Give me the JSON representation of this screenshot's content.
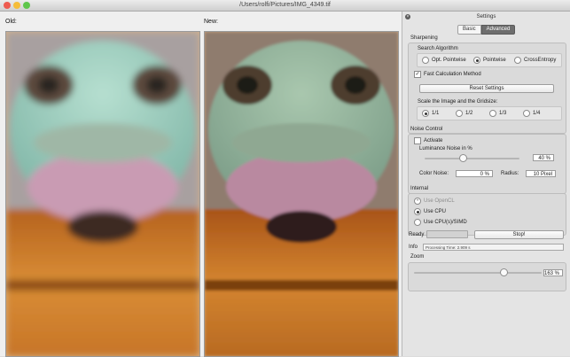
{
  "window": {
    "title": "/Users/rolfi/Pictures/IMG_4349.tif"
  },
  "viewer": {
    "old_label": "Old:",
    "new_label": "New:"
  },
  "settings": {
    "title": "Settings",
    "tabs": [
      {
        "label": "Basic",
        "active": false
      },
      {
        "label": "Advanced",
        "active": true
      }
    ],
    "sharpening": {
      "label": "Sharpening",
      "search_algorithm": {
        "label": "Search Algorithm",
        "options": [
          "Opt. Pointwise",
          "Pointwise",
          "CrossEntropy"
        ],
        "selected": "Pointwise"
      },
      "fast_calc": {
        "label": "Fast Calculation Method",
        "checked": true
      },
      "reset_label": "Reset Settings",
      "scale": {
        "label": "Scale the Image and the Gridsize:",
        "options": [
          "1/1",
          "1/2",
          "1/3",
          "1/4"
        ],
        "selected": "1/1"
      }
    },
    "noise": {
      "label": "Noise Control",
      "activate": {
        "label": "Activate",
        "checked": false
      },
      "luminance_label": "Luminance Noise in %",
      "luminance_value": "40 %",
      "luminance_level": 0.4,
      "color_noise_label": "Color Noise:",
      "color_noise_value": "0 %",
      "radius_label": "Radius:",
      "radius_value": "10 Pixel"
    },
    "internal": {
      "label": "Internal",
      "options": [
        {
          "label": "Use OpenCL",
          "checked": true,
          "disabled": true
        },
        {
          "label": "Use CPU",
          "checked": true,
          "disabled": false
        },
        {
          "label": "Use CPU(s)/SIMD",
          "checked": false,
          "disabled": false
        }
      ]
    },
    "status": {
      "ready_label": "Ready",
      "stop_label": "Stop!",
      "info_label": "Info",
      "info_text": "Processing Time: 2.909 s"
    },
    "zoom": {
      "label": "Zoom",
      "value": "163 %",
      "level": 0.7
    }
  },
  "colors": {
    "accent": "#6e6e6e",
    "close_red": "#ee5b50",
    "minimize_yellow": "#f5bd3a",
    "zoom_green": "#5ec64b"
  }
}
